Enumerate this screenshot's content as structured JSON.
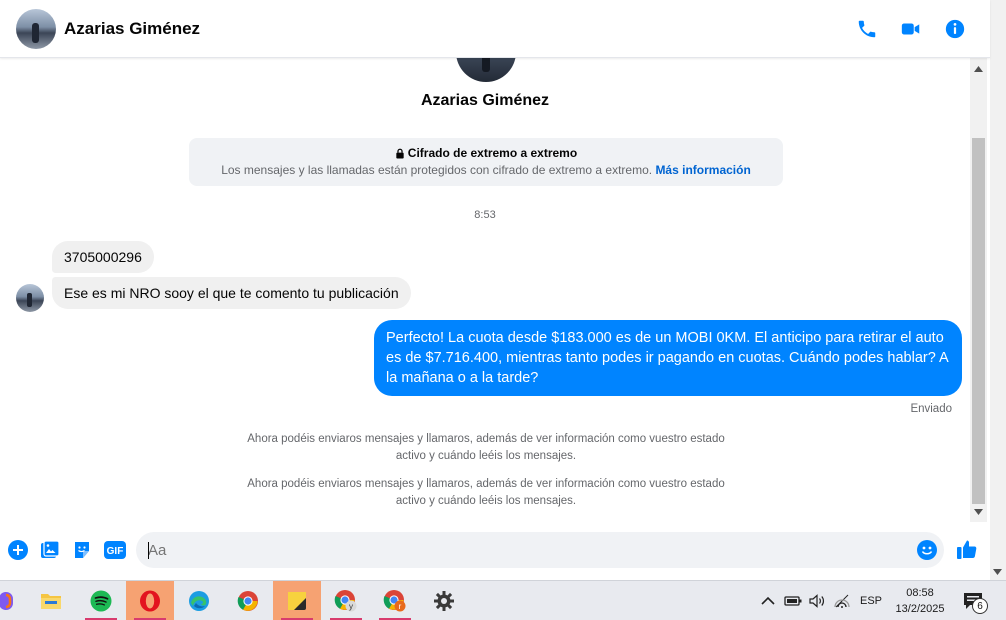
{
  "header": {
    "contact_name": "Azarias Giménez",
    "icons": [
      "phone-icon",
      "video-camera-icon",
      "info-icon"
    ],
    "accent_color": "#0084ff"
  },
  "chat": {
    "profile_name": "Azarias Giménez",
    "encryption": {
      "title": "Cifrado de extremo a extremo",
      "body": "Los mensajes y las llamadas están protegidos con cifrado de extremo a extremo.",
      "link": "Más información"
    },
    "timestamp": "8:53",
    "messages": [
      {
        "from": "contact",
        "text": "3705000296"
      },
      {
        "from": "contact",
        "text": "Ese es mi NRO sooy el que te comento tu publicación"
      },
      {
        "from": "me",
        "text": "Perfecto! La cuota desde $183.000 es de un MOBI 0KM. El anticipo para retirar el auto es de $7.716.400, mientras tanto podes ir pagando en cuotas. Cuándo podes hablar? A la mañana o a la tarde?"
      }
    ],
    "status": "Enviado",
    "notices": [
      "Ahora podéis enviaros mensajes y llamaros, además de ver información como vuestro estado activo y cuándo leéis los mensajes.",
      "Ahora podéis enviaros mensajes y llamaros, además de ver información como vuestro estado activo y cuándo leéis los mensajes."
    ]
  },
  "composer": {
    "placeholder": "Aa",
    "icons": [
      "add-icon",
      "photo-icon",
      "sticker-icon",
      "gif-icon",
      "emoji-icon",
      "like-icon"
    ],
    "gif_label": "GIF"
  },
  "taskbar": {
    "apps": [
      "copilot-icon",
      "file-explorer-icon",
      "spotify-icon",
      "opera-icon",
      "edge-icon",
      "chrome-icon",
      "sticky-notes-icon",
      "chrome-profile-y-icon",
      "chrome-profile-r-icon",
      "settings-icon"
    ],
    "language": "ESP",
    "time": "08:58",
    "date": "13/2/2025",
    "notification_count": "6"
  }
}
